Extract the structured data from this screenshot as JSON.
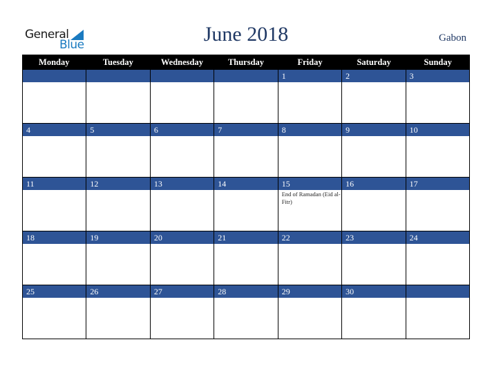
{
  "logo": {
    "general": "General",
    "blue": "Blue"
  },
  "header": {
    "title": "June 2018",
    "country": "Gabon"
  },
  "colors": {
    "title": "#1f3864",
    "date_strip": "#2e5496",
    "header_bg": "#000000",
    "logo_blue": "#1a7ac0"
  },
  "weekdays": [
    "Monday",
    "Tuesday",
    "Wednesday",
    "Thursday",
    "Friday",
    "Saturday",
    "Sunday"
  ],
  "weeks": [
    [
      {
        "day": ""
      },
      {
        "day": ""
      },
      {
        "day": ""
      },
      {
        "day": ""
      },
      {
        "day": "1"
      },
      {
        "day": "2"
      },
      {
        "day": "3"
      }
    ],
    [
      {
        "day": "4"
      },
      {
        "day": "5"
      },
      {
        "day": "6"
      },
      {
        "day": "7"
      },
      {
        "day": "8"
      },
      {
        "day": "9"
      },
      {
        "day": "10"
      }
    ],
    [
      {
        "day": "11"
      },
      {
        "day": "12"
      },
      {
        "day": "13"
      },
      {
        "day": "14"
      },
      {
        "day": "15",
        "event": "End of Ramadan (Eid al-Fitr)"
      },
      {
        "day": "16"
      },
      {
        "day": "17"
      }
    ],
    [
      {
        "day": "18"
      },
      {
        "day": "19"
      },
      {
        "day": "20"
      },
      {
        "day": "21"
      },
      {
        "day": "22"
      },
      {
        "day": "23"
      },
      {
        "day": "24"
      }
    ],
    [
      {
        "day": "25"
      },
      {
        "day": "26"
      },
      {
        "day": "27"
      },
      {
        "day": "28"
      },
      {
        "day": "29"
      },
      {
        "day": "30"
      },
      {
        "day": ""
      }
    ]
  ]
}
